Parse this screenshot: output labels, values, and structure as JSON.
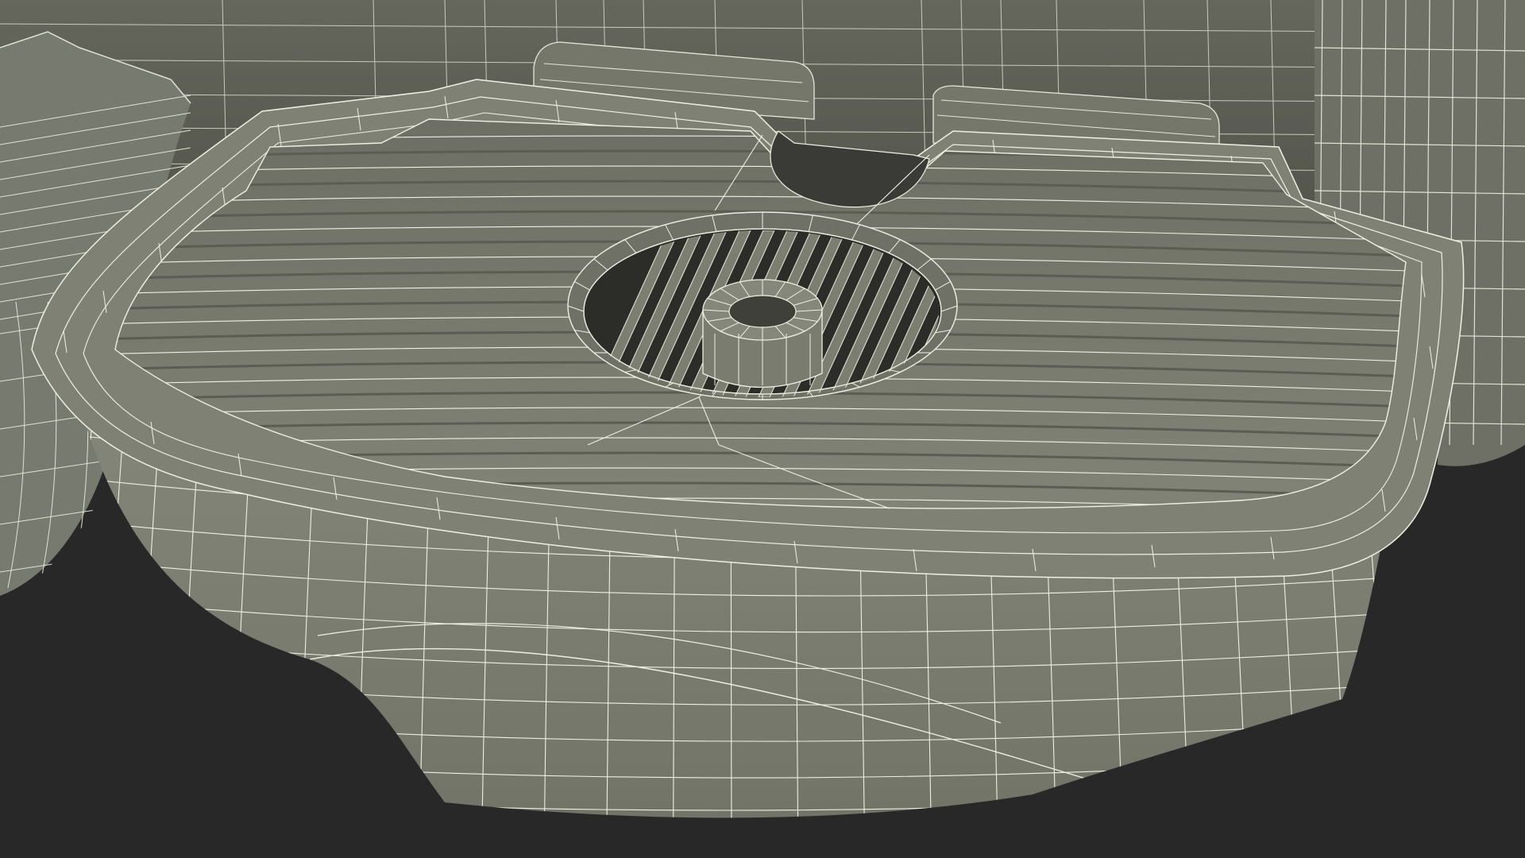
{
  "scene": {
    "background_color": "#282828",
    "surface_color": "#7b7d70",
    "surface_shadow_color": "#5d5f55",
    "wire_color": "#e8ecdc",
    "render_style": "wireframe-on-shaded"
  }
}
